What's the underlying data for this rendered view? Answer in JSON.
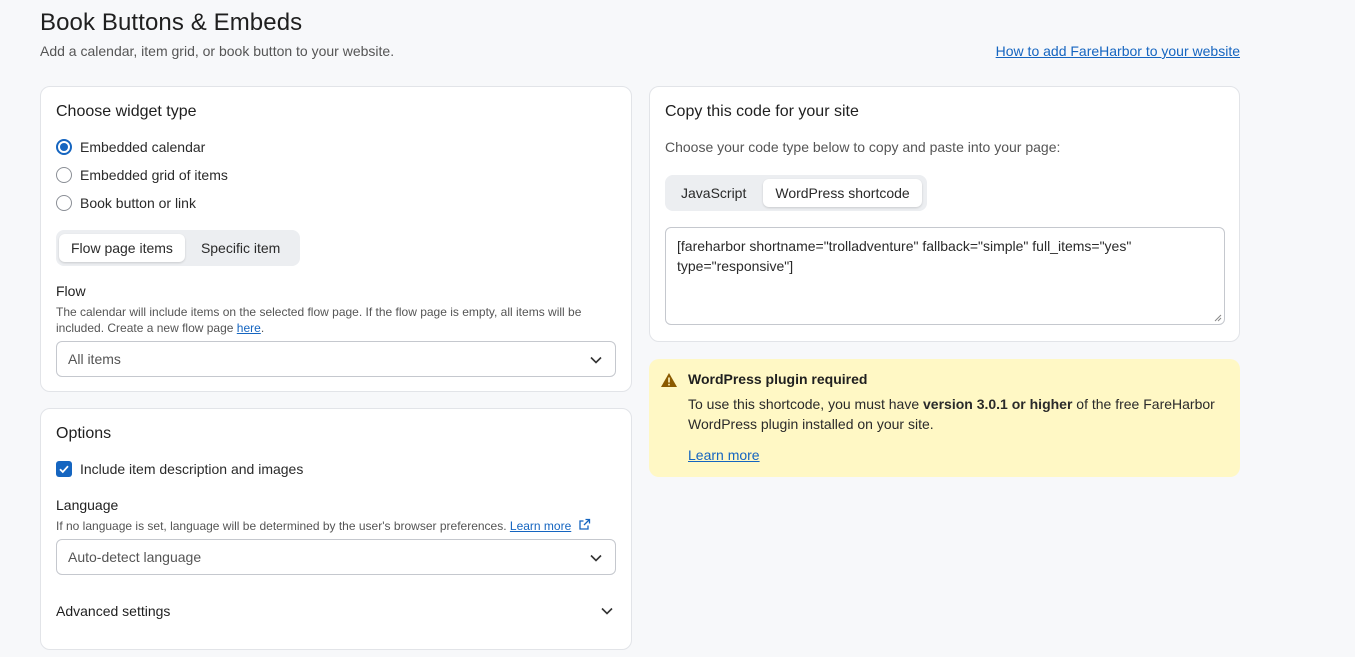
{
  "header": {
    "title": "Book Buttons & Embeds",
    "subtitle": "Add a calendar, item grid, or book button to your website.",
    "help_link": "How to add FareHarbor to your website"
  },
  "widget_card": {
    "title": "Choose widget type",
    "options": [
      {
        "label": "Embedded calendar",
        "selected": true
      },
      {
        "label": "Embedded grid of items",
        "selected": false
      },
      {
        "label": "Book button or link",
        "selected": false
      }
    ],
    "source_tabs": [
      {
        "label": "Flow page items",
        "active": true
      },
      {
        "label": "Specific item",
        "active": false
      }
    ],
    "flow": {
      "label": "Flow",
      "help_part1": "The calendar will include items on the selected flow page. If the flow page is empty, all items will be included. Create a new flow page ",
      "help_link": "here",
      "help_end": ".",
      "value": "All items"
    }
  },
  "options_card": {
    "title": "Options",
    "include_checkbox": {
      "label": "Include item description and images",
      "checked": true
    },
    "language": {
      "label": "Language",
      "help": "If no language is set, language will be determined by the user's browser preferences. ",
      "help_link": "Learn more",
      "value": "Auto-detect language"
    },
    "advanced": "Advanced settings"
  },
  "code_card": {
    "title": "Copy this code for your site",
    "intro": "Choose your code type below to copy and paste into your page:",
    "tabs": [
      {
        "label": "JavaScript",
        "active": false
      },
      {
        "label": "WordPress shortcode",
        "active": true
      }
    ],
    "code": "[fareharbor shortname=\"trolladventure\" fallback=\"simple\" full_items=\"yes\" type=\"responsive\"]"
  },
  "warning": {
    "title": "WordPress plugin required",
    "text_part1": "To use this shortcode, you must have ",
    "text_bold": "version 3.0.1 or higher",
    "text_part2": " of the free FareHarbor WordPress plugin installed on your site.",
    "link": "Learn more"
  },
  "colors": {
    "accent": "#1565c0",
    "warning_bg": "#fff8c5",
    "warning_icon": "#8a5a00",
    "page_bg": "#f7f8fa"
  }
}
